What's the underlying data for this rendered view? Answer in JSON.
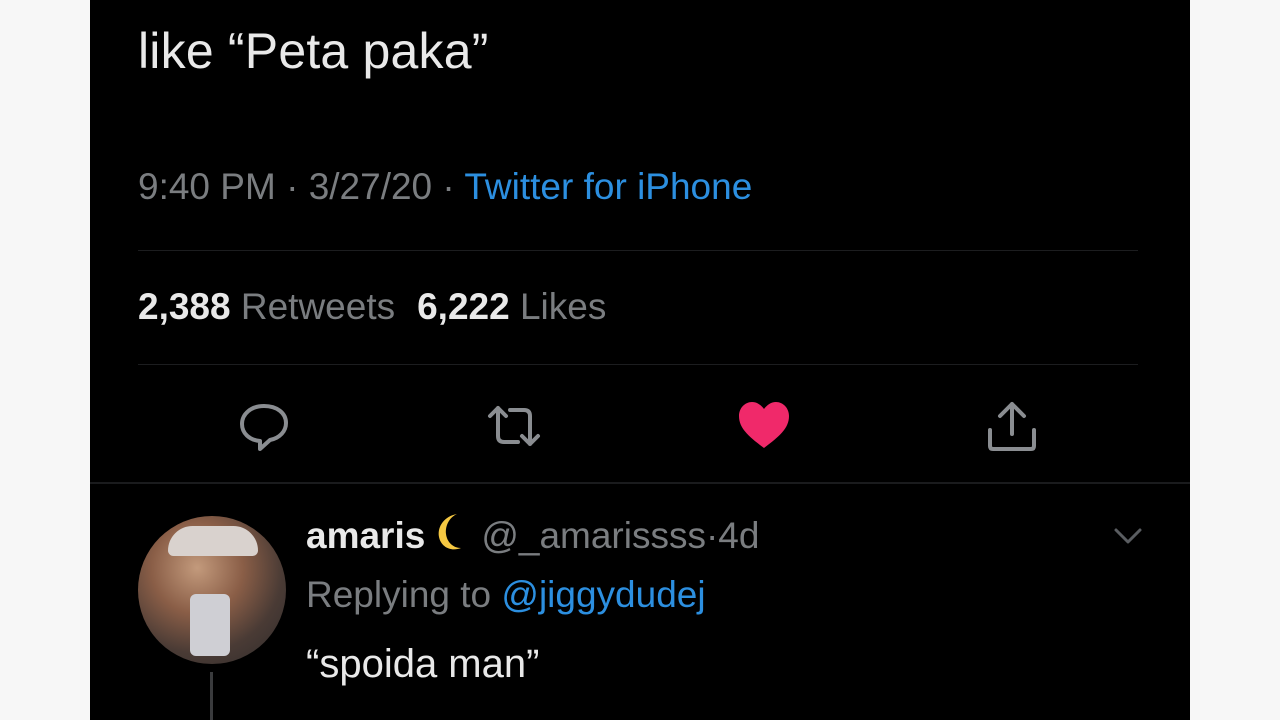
{
  "tweet": {
    "text_fragment": "like “Peta paka”",
    "time": "9:40 PM",
    "date": "3/27/20",
    "separator": "·",
    "source": "Twitter for iPhone",
    "retweets_count": "2,388",
    "retweets_label": "Retweets",
    "likes_count": "6,222",
    "likes_label": "Likes",
    "liked": true,
    "like_color": "#f0296a",
    "source_color": "#2c8fe0"
  },
  "actions": [
    {
      "icon": "reply-icon"
    },
    {
      "icon": "retweet-icon"
    },
    {
      "icon": "heart-icon"
    },
    {
      "icon": "share-icon"
    }
  ],
  "reply": {
    "display_name": "amaris",
    "emoji_icon": "crescent-moon-icon",
    "handle": "@_amarissss",
    "age": "4d",
    "replying_prefix": "Replying to",
    "replying_to": "@jiggydudej",
    "text": "“spoida man”"
  }
}
